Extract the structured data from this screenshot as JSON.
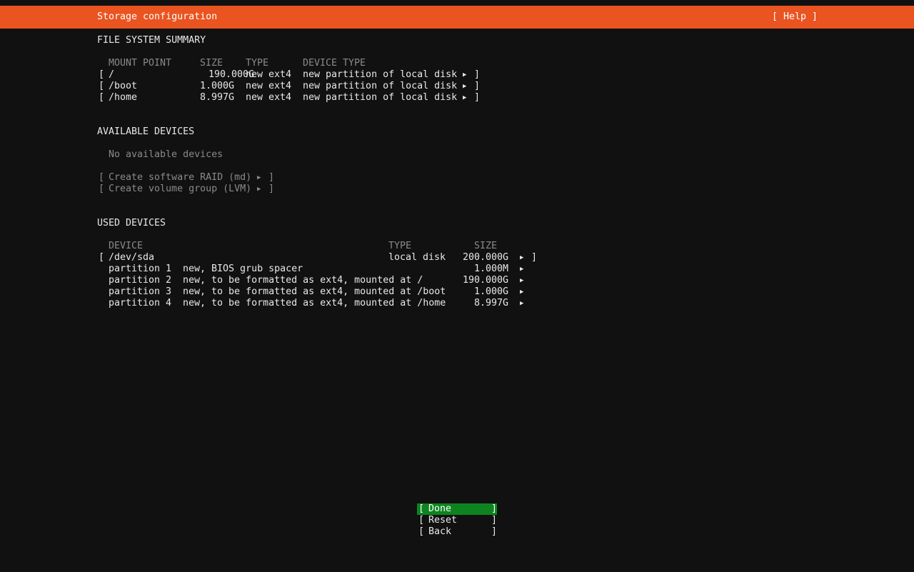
{
  "header": {
    "title": "Storage configuration",
    "help_label": "[ Help ]"
  },
  "fs_summary": {
    "heading": "FILE SYSTEM SUMMARY",
    "columns": {
      "mount_point": "MOUNT POINT",
      "size": "SIZE",
      "type": "TYPE",
      "device_type": "DEVICE TYPE"
    },
    "rows": [
      {
        "mount": "/",
        "size": "190.000G",
        "type": "new ext4",
        "device_type": "new partition of local disk"
      },
      {
        "mount": "/boot",
        "size": "1.000G",
        "type": "new ext4",
        "device_type": "new partition of local disk"
      },
      {
        "mount": "/home",
        "size": "8.997G",
        "type": "new ext4",
        "device_type": "new partition of local disk"
      }
    ]
  },
  "available": {
    "heading": "AVAILABLE DEVICES",
    "empty_text": "No available devices",
    "actions": [
      {
        "label": "Create software RAID (md)"
      },
      {
        "label": "Create volume group (LVM)"
      }
    ]
  },
  "used": {
    "heading": "USED DEVICES",
    "columns": {
      "device": "DEVICE",
      "type": "TYPE",
      "size": "SIZE"
    },
    "disk": {
      "name": "/dev/sda",
      "type": "local disk",
      "size": "200.000G"
    },
    "partitions": [
      {
        "name": "partition 1",
        "desc": "new, BIOS grub spacer",
        "size": "1.000M"
      },
      {
        "name": "partition 2",
        "desc": "new, to be formatted as ext4, mounted at /",
        "size": "190.000G"
      },
      {
        "name": "partition 3",
        "desc": "new, to be formatted as ext4, mounted at /boot",
        "size": "1.000G"
      },
      {
        "name": "partition 4",
        "desc": "new, to be formatted as ext4, mounted at /home",
        "size": "8.997G"
      }
    ]
  },
  "glyphs": {
    "bracket_open": "[",
    "bracket_close": "]",
    "arrow": "▶"
  },
  "buttons": {
    "done": "Done",
    "reset": "Reset",
    "back": "Back"
  },
  "colors": {
    "accent": "#e95420",
    "done_bg": "#0e8420",
    "background": "#111111"
  }
}
